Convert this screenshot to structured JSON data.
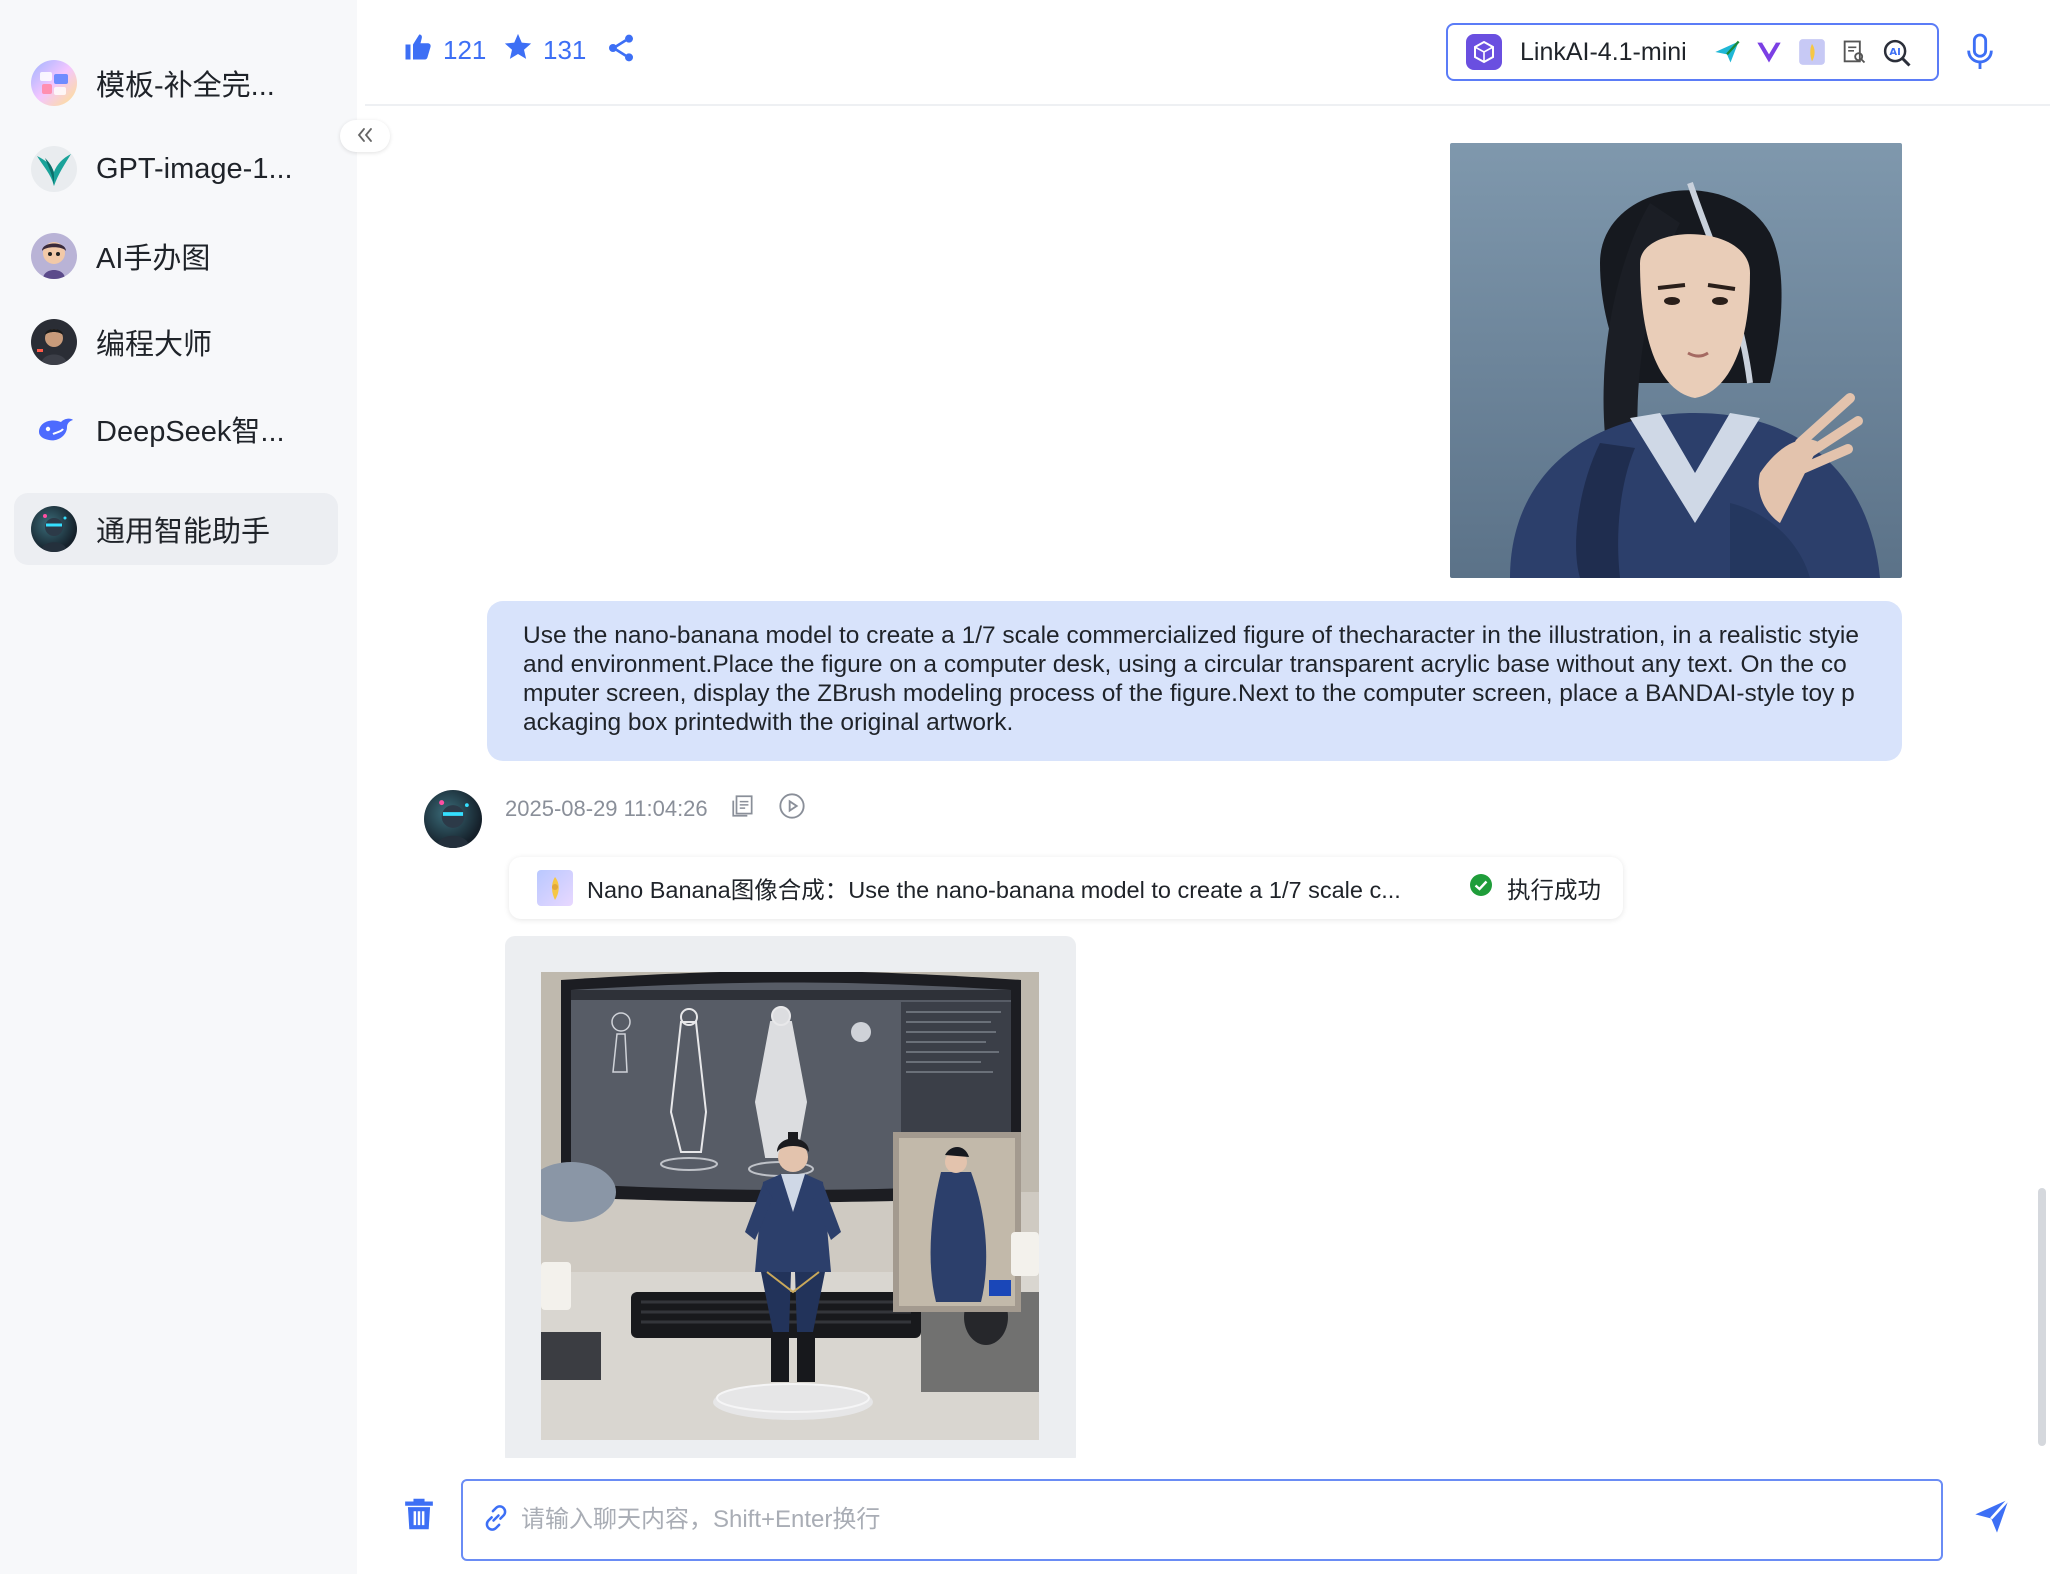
{
  "sidebar": {
    "items": [
      {
        "label": "模板-补全完..."
      },
      {
        "label": "GPT-image-1..."
      },
      {
        "label": "AI手办图"
      },
      {
        "label": "编程大师"
      },
      {
        "label": "DeepSeek智..."
      },
      {
        "label": "通用智能助手",
        "active": true
      }
    ],
    "collapse_icon": "double-chevron-left-icon"
  },
  "header": {
    "likes": "121",
    "stars": "131",
    "model_name": "LinkAI-4.1-mini",
    "tools": [
      "send-icon",
      "vue-logo-icon",
      "banana-icon",
      "document-search-icon",
      "ai-search-icon"
    ]
  },
  "conversation": {
    "user_message": "Use the nano-banana model to create a 1/7 scale commercialized figure of thecharacter in the illustration, in a realistic styie and environment.Place the figure on a computer desk, using a circular transparent acrylic base without any text. On the computer screen, display the ZBrush modeling process of the figure.Next to the computer screen, place a BANDAI-style toy packaging box printedwith the original artwork.",
    "bot_timestamp": "2025-08-29 11:04:26",
    "tool_call": {
      "text": "Nano Banana图像合成：Use the nano-banana model to create a 1/7 scale c...",
      "status": "执行成功"
    }
  },
  "input": {
    "placeholder": "请输入聊天内容，Shift+Enter换行",
    "value": ""
  },
  "colors": {
    "accent": "#3d6ff5",
    "user_bubble": "#d8e3fb",
    "success": "#1f9d3a"
  }
}
